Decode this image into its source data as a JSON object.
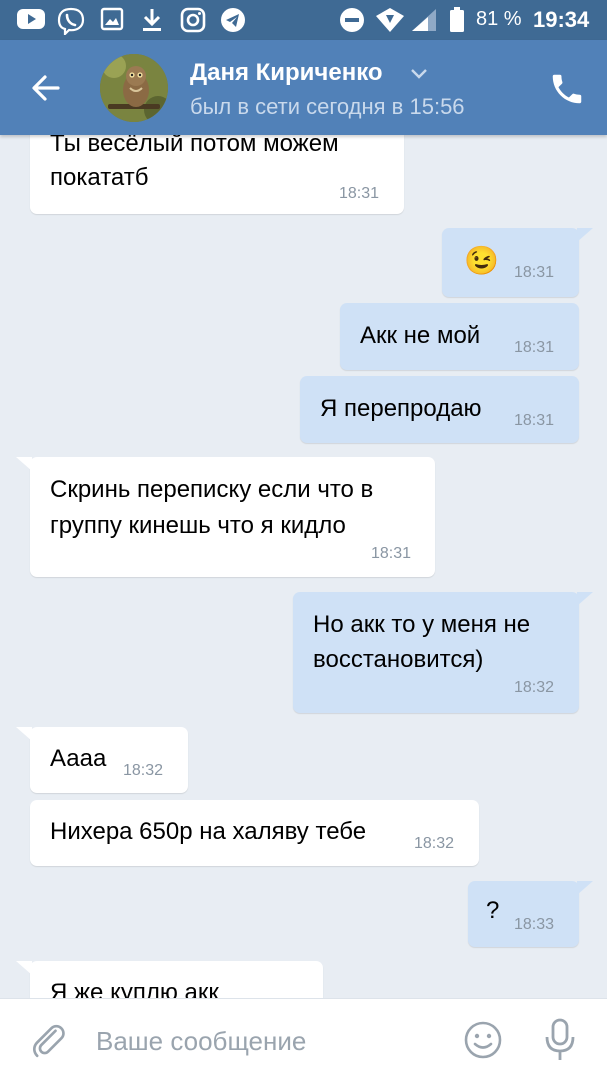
{
  "status_bar": {
    "battery": "81 %",
    "time": "19:34",
    "icons": [
      "youtube-icon",
      "viber-icon",
      "gallery-icon",
      "download-icon",
      "instagram-icon",
      "telegram-icon",
      "do-not-disturb-icon",
      "wifi-icon",
      "signal-icon",
      "battery-icon"
    ]
  },
  "header": {
    "name": "Даня Кириченко",
    "status": "был в сети сегодня в 15:56",
    "icons": [
      "back-arrow-icon",
      "chevron-down-icon",
      "phone-icon"
    ]
  },
  "messages": [
    {
      "direction": "in",
      "lines": [
        "Ты весёлый потом можем",
        "покататб"
      ],
      "time": "18:31"
    },
    {
      "direction": "out",
      "lines": [
        "😉"
      ],
      "time": "18:31"
    },
    {
      "direction": "out",
      "lines": [
        "Акк не мой"
      ],
      "time": "18:31"
    },
    {
      "direction": "out",
      "lines": [
        "Я перепродаю"
      ],
      "time": "18:31"
    },
    {
      "direction": "in",
      "lines": [
        "Скринь переписку если что в",
        "группу кинешь что я кидло"
      ],
      "time": "18:31"
    },
    {
      "direction": "out",
      "lines": [
        "Но акк то у меня не",
        "восстановится)"
      ],
      "time": "18:32"
    },
    {
      "direction": "in",
      "lines": [
        "Аааа"
      ],
      "time": "18:32"
    },
    {
      "direction": "in",
      "lines": [
        "Нихера 650р на халяву тебе"
      ],
      "time": "18:32"
    },
    {
      "direction": "out",
      "lines": [
        "?"
      ],
      "time": "18:33"
    },
    {
      "direction": "in",
      "lines": [
        "Я же куплю акк"
      ],
      "time": ""
    }
  ],
  "input_bar": {
    "placeholder": "Ваше сообщение",
    "icons": [
      "paperclip-icon",
      "emoji-icon",
      "microphone-icon"
    ]
  },
  "colors": {
    "status_bar": "#3f6a94",
    "header": "#5181b8",
    "chat_background": "#e8edf3",
    "incoming_bubble": "#ffffff",
    "outgoing_bubble": "#cfe1f6",
    "timestamp": "#8a96a3"
  }
}
